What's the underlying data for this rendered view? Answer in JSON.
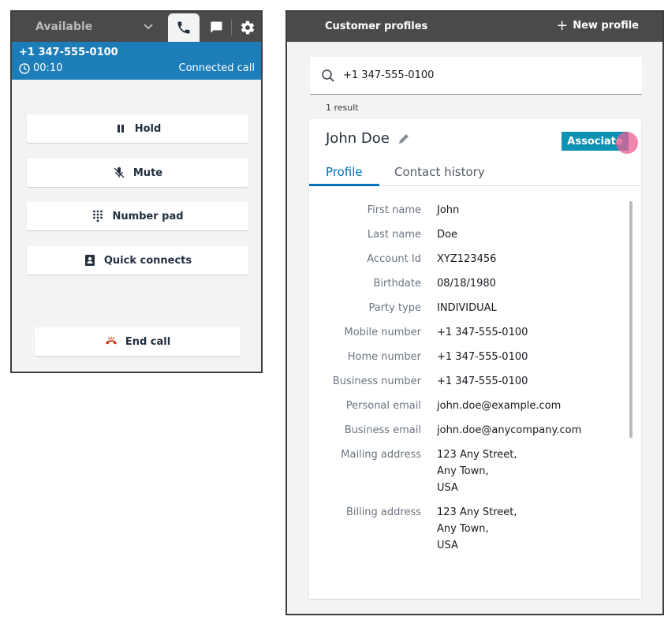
{
  "ccp": {
    "status": "Available",
    "call": {
      "number": "+1 347-555-0100",
      "timer": "00:10",
      "state": "Connected call"
    },
    "buttons": {
      "hold": "Hold",
      "mute": "Mute",
      "number_pad": "Number pad",
      "quick_connects": "Quick connects",
      "end_call": "End call"
    },
    "colors": {
      "call_bar": "#1c7db9",
      "end_call_icon": "#d13212"
    }
  },
  "customer_profiles": {
    "title": "Customer profiles",
    "new_profile": "New profile",
    "search_value": "+1 347-555-0100",
    "result_count": "1 result",
    "profile": {
      "name": "John Doe",
      "associate_label": "Associate",
      "tabs": [
        "Profile",
        "Contact history"
      ],
      "fields": [
        {
          "label": "First  name",
          "value": "John"
        },
        {
          "label": "Last name",
          "value": "Doe"
        },
        {
          "label": "Account Id",
          "value": "XYZ123456"
        },
        {
          "label": "Birthdate",
          "value": "08/18/1980"
        },
        {
          "label": "Party type",
          "value": "INDIVIDUAL"
        },
        {
          "label": "Mobile number",
          "value": "+1 347-555-0100"
        },
        {
          "label": "Home number",
          "value": "+1 347-555-0100"
        },
        {
          "label": "Business number",
          "value": "+1 347-555-0100"
        },
        {
          "label": "Personal email",
          "value": "john.doe@example.com"
        },
        {
          "label": "Business email",
          "value": "john.doe@anycompany.com"
        },
        {
          "label": "Mailing address",
          "value": "123 Any Street,\nAny Town,\nUSA"
        },
        {
          "label": "Billing address",
          "value": "123 Any Street,\nAny Town,\nUSA"
        }
      ]
    },
    "colors": {
      "accent": "#0073bb",
      "associate_button": "#0d92b3"
    }
  }
}
